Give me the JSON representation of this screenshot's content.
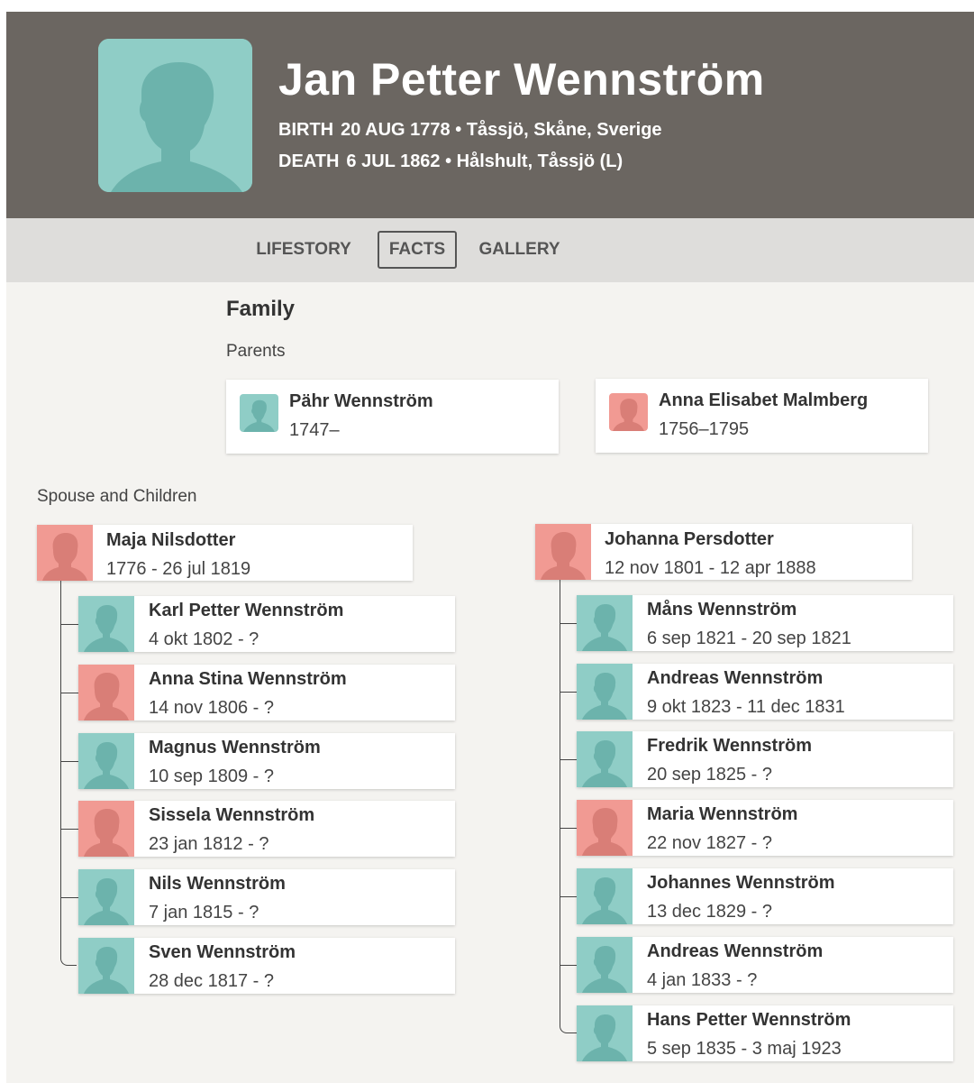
{
  "person": {
    "name": "Jan Petter Wennström",
    "birth_label": "BIRTH",
    "birth_value": "20 AUG 1778 • Tåssjö, Skåne, Sverige",
    "death_label": "DEATH",
    "death_value": "6 JUL 1862 • Hålshult, Tåssjö (L)"
  },
  "tabs": [
    {
      "label": "LIFESTORY",
      "active": false
    },
    {
      "label": "FACTS",
      "active": true
    },
    {
      "label": "GALLERY",
      "active": false
    }
  ],
  "family": {
    "title": "Family",
    "parents_label": "Parents",
    "parents": [
      {
        "name": "Pähr Wennström",
        "dates": "1747–",
        "gender": "male"
      },
      {
        "name": "Anna Elisabet Malmberg",
        "dates": "1756–1795",
        "gender": "female"
      }
    ],
    "spouses_label": "Spouse and Children",
    "spouses": [
      {
        "name": "Maja Nilsdotter",
        "dates": "1776 - 26 jul 1819",
        "gender": "female",
        "children": [
          {
            "name": "Karl Petter Wennström",
            "dates": "4 okt 1802 - ?",
            "gender": "male"
          },
          {
            "name": "Anna Stina Wennström",
            "dates": "14 nov 1806 - ?",
            "gender": "female"
          },
          {
            "name": "Magnus Wennström",
            "dates": "10 sep 1809 - ?",
            "gender": "male"
          },
          {
            "name": "Sissela Wennström",
            "dates": "23 jan 1812 - ?",
            "gender": "female"
          },
          {
            "name": "Nils Wennström",
            "dates": "7 jan 1815 - ?",
            "gender": "male"
          },
          {
            "name": "Sven Wennström",
            "dates": "28 dec 1817 - ?",
            "gender": "male"
          }
        ]
      },
      {
        "name": "Johanna Persdotter",
        "dates": "12 nov 1801 - 12 apr 1888",
        "gender": "female",
        "children": [
          {
            "name": "Måns Wennström",
            "dates": "6 sep 1821 - 20 sep 1821",
            "gender": "male"
          },
          {
            "name": "Andreas Wennström",
            "dates": "9 okt 1823 - 11 dec 1831",
            "gender": "male"
          },
          {
            "name": "Fredrik Wennström",
            "dates": "20 sep 1825 - ?",
            "gender": "male"
          },
          {
            "name": "Maria Wennström",
            "dates": "22 nov 1827 - ?",
            "gender": "female"
          },
          {
            "name": "Johannes Wennström",
            "dates": "13 dec 1829 - ?",
            "gender": "male"
          },
          {
            "name": "Andreas Wennström",
            "dates": "4 jan 1833 - ?",
            "gender": "male"
          },
          {
            "name": "Hans Petter Wennström",
            "dates": "5 sep 1835 - 3 maj 1923",
            "gender": "male"
          }
        ]
      }
    ]
  },
  "colors": {
    "header_bg": "#6b6661",
    "tabs_bg": "#dedddb",
    "page_bg": "#f4f3f0",
    "male_bg": "#8fcdc6",
    "male_fg": "#6cb3ac",
    "female_bg": "#f19a93",
    "female_fg": "#d97e77"
  },
  "icons": {
    "male": "male-silhouette-icon",
    "female": "female-silhouette-icon"
  }
}
